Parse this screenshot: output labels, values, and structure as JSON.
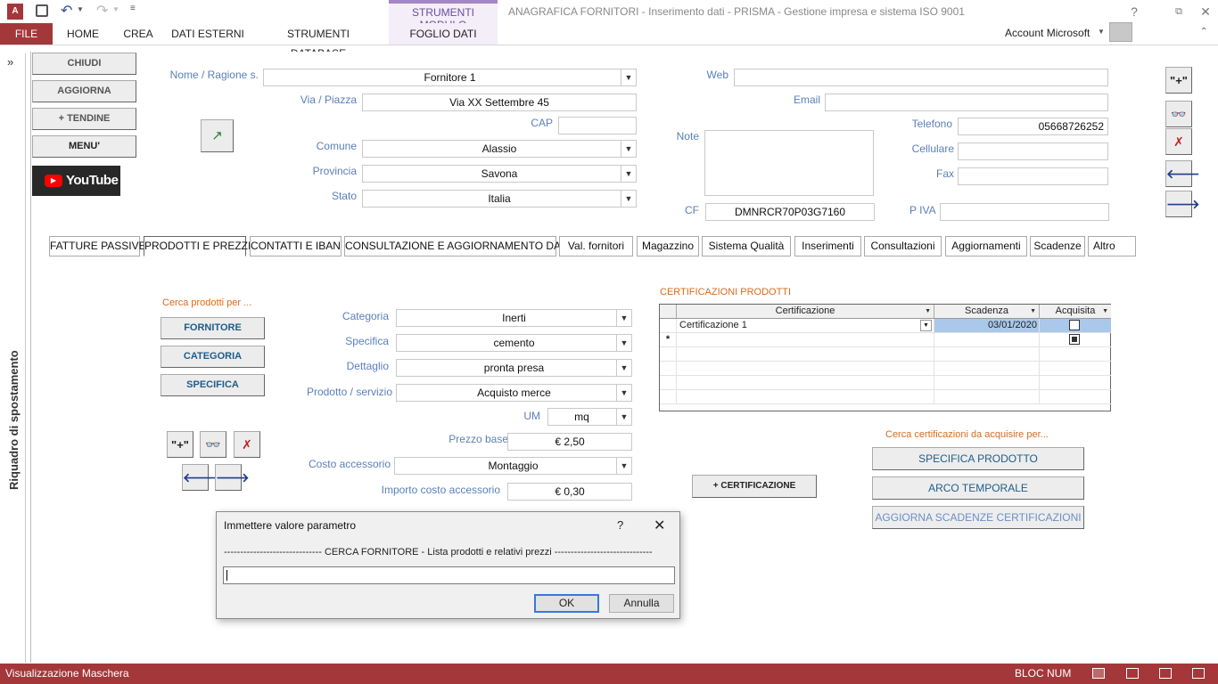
{
  "titlebar": {
    "title": "ANAGRAFICA FORNITORI - Inserimento dati - PRISMA - Gestione impresa e sistema ISO 9001",
    "tool_group": "STRUMENTI MODULO",
    "account": "Account Microsoft",
    "help": "?"
  },
  "ribbon": {
    "tabs": [
      "FILE",
      "HOME",
      "CREA",
      "DATI ESTERNI",
      "STRUMENTI DATABASE",
      "FOGLIO DATI"
    ]
  },
  "nav_pane": {
    "label": "Riquadro di spostamento",
    "toggle": "»"
  },
  "side_buttons": {
    "chiudi": "CHIUDI",
    "aggiorna": "AGGIORNA",
    "tendine": "+ TENDINE",
    "menu": "MENU'",
    "youtube": "YouTube"
  },
  "header_form": {
    "nome_label": "Nome / Ragione s.",
    "nome_value": "Fornitore 1",
    "via_label": "Via / Piazza",
    "via_value": "Via XX Settembre 45",
    "cap_label": "CAP",
    "cap_value": "",
    "comune_label": "Comune",
    "comune_value": "Alassio",
    "provincia_label": "Provincia",
    "provincia_value": "Savona",
    "stato_label": "Stato",
    "stato_value": "Italia",
    "web_label": "Web",
    "web_value": "",
    "email_label": "Email",
    "email_value": "",
    "note_label": "Note",
    "note_value": "",
    "telefono_label": "Telefono",
    "telefono_value": "05668726252",
    "cellulare_label": "Cellulare",
    "cellulare_value": "",
    "fax_label": "Fax",
    "fax_value": "",
    "cf_label": "CF",
    "cf_value": "DMNRCR70P03G7160",
    "piva_label": "P IVA",
    "piva_value": ""
  },
  "form_tabs": [
    "FATTURE PASSIVE",
    "PRODOTTI E PREZZI",
    "CONTATTI E IBAN",
    "CONSULTAZIONE E AGGIORNAMENTO DATI",
    "Val. fornitori",
    "Magazzino",
    "Sistema Qualità",
    "Inserimenti",
    "Consultazioni",
    "Aggiornamenti",
    "Scadenze",
    "Altro"
  ],
  "products": {
    "search_title": "Cerca prodotti per ...",
    "search_buttons": [
      "FORNITORE",
      "CATEGORIA",
      "SPECIFICA"
    ],
    "categoria_label": "Categoria",
    "categoria_value": "Inerti",
    "specifica_label": "Specifica",
    "specifica_value": "cemento",
    "dettaglio_label": "Dettaglio",
    "dettaglio_value": "pronta presa",
    "prodotto_label": "Prodotto / servizio",
    "prodotto_value": "Acquisto merce",
    "um_label": "UM",
    "um_value": "mq",
    "prezzo_label": "Prezzo base",
    "prezzo_value": "€ 2,50",
    "costo_label": "Costo accessorio",
    "costo_value": "Montaggio",
    "importo_label": "Importo costo accessorio",
    "importo_value": "€ 0,30",
    "add_cert_button": "+ CERTIFICAZIONE"
  },
  "certifications": {
    "title": "CERTIFICAZIONI PRODOTTI",
    "columns": [
      "Certificazione",
      "Scadenza",
      "Acquisita"
    ],
    "rows": [
      {
        "certificazione": "Certificazione 1",
        "scadenza": "03/01/2020",
        "acquisita": false
      }
    ],
    "new_row_marker": "*",
    "search_title": "Cerca certificazioni da acquisire per...",
    "buttons": [
      "SPECIFICA PRODOTTO",
      "ARCO TEMPORALE",
      "AGGIORNA SCADENZE CERTIFICAZIONI"
    ]
  },
  "dialog": {
    "title": "Immettere valore parametro",
    "help": "?",
    "prompt": "------------------------------ CERCA FORNITORE -  Lista prodotti e relativi prezzi ------------------------------",
    "input_value": "",
    "ok": "OK",
    "cancel": "Annulla"
  },
  "statusbar": {
    "left": "Visualizzazione Maschera",
    "right": "BLOC NUM"
  },
  "colors": {
    "brand": "#a4373a",
    "tool_tab": "#a386c6",
    "label_blue": "#5a7fb8",
    "label_orange": "#d86b1e"
  }
}
